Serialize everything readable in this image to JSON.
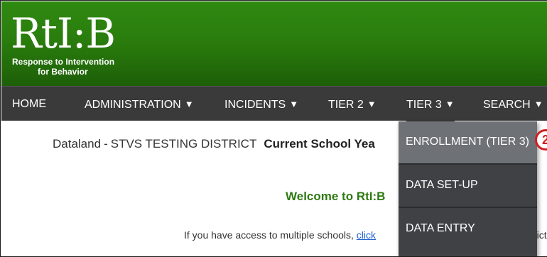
{
  "logo": {
    "main": "RtI:B",
    "tagline_1": "Response to Intervention",
    "tagline_2": "for Behavior"
  },
  "nav": {
    "items": [
      {
        "label": "HOME",
        "has_arrow": false
      },
      {
        "label": "ADMINISTRATION",
        "has_arrow": true
      },
      {
        "label": "INCIDENTS",
        "has_arrow": true
      },
      {
        "label": "TIER 2",
        "has_arrow": true
      },
      {
        "label": "TIER 3",
        "has_arrow": true
      },
      {
        "label": "SEARCH",
        "has_arrow": true
      }
    ],
    "arrow_glyph": "▼"
  },
  "main": {
    "district": "Dataland",
    "separator": "-",
    "district_name": "STVS TESTING DISTRICT",
    "current_year_label": "Current School Yea",
    "welcome": "Welcome to RtI:B",
    "access_text": "If you have access to multiple schools,",
    "access_link": "click",
    "access_trail": "rict"
  },
  "dropdown": {
    "items": [
      {
        "label": "ENROLLMENT (TIER 3)",
        "highlighted": true
      },
      {
        "label": "DATA SET-UP",
        "highlighted": false
      },
      {
        "label": "DATA ENTRY",
        "highlighted": false
      }
    ]
  },
  "callout_badge": "2",
  "colors": {
    "header_green": "#2a7d0d",
    "nav_bg": "#3a3a3a",
    "dropdown_bg": "#3f4144",
    "dropdown_hover": "#6e7176",
    "welcome_green": "#2e7a12",
    "link_blue": "#1a5fd0",
    "badge_red": "#d11f1f"
  }
}
